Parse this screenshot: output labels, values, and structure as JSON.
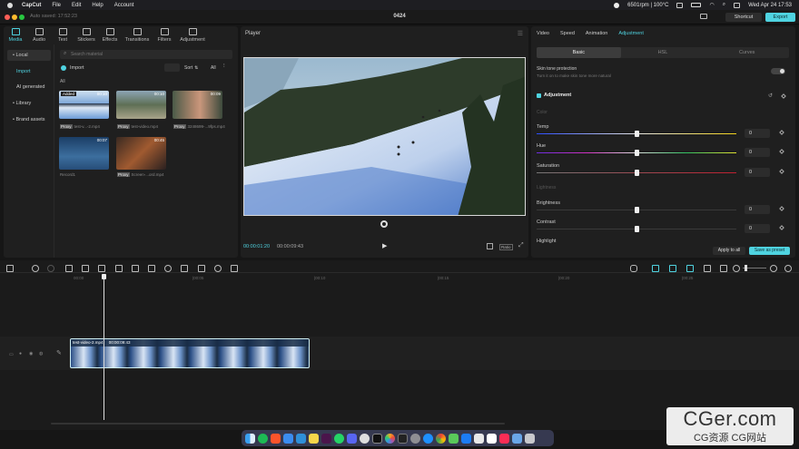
{
  "menubar": {
    "app": "CapCut",
    "items": [
      "File",
      "Edit",
      "Help",
      "Account"
    ],
    "status": "6501rpm | 100°C",
    "datetime": "Wed Apr 24  17:53"
  },
  "titlebar": {
    "autosaved": "Auto saved: 17:52:23",
    "project": "0424",
    "shortcut": "Shortcut",
    "export": "Export"
  },
  "media": {
    "tabs": [
      "Media",
      "Audio",
      "Text",
      "Stickers",
      "Effects",
      "Transitions",
      "Filters",
      "Adjustment"
    ],
    "side": [
      "• Local",
      "Import",
      "AI generated",
      "• Library",
      "• Brand assets"
    ],
    "search_placeholder": "Search material",
    "import_label": "Import",
    "sort": "Sort",
    "all_filter": "All",
    "section": "All",
    "clips": [
      {
        "badge": "Added",
        "duration": "00:10",
        "tag": "Proxy",
        "name": "test-v...-2.mp4"
      },
      {
        "duration": "00:10",
        "tag": "Proxy",
        "name": "test-video.mp4"
      },
      {
        "duration": "00:09",
        "tag": "Proxy",
        "name": "3248699-...9fps.mp4"
      },
      {
        "duration": "00:07",
        "tag": "",
        "name": "Record1"
      },
      {
        "duration": "00:45",
        "tag": "Proxy",
        "name": "Screen-...ord.mp4"
      }
    ]
  },
  "player": {
    "title": "Player",
    "current": "00:00:01:20",
    "total": "00:00:09:43",
    "ratio": "Ratio"
  },
  "adjust": {
    "tabs": [
      "Video",
      "Speed",
      "Animation",
      "Adjustment"
    ],
    "subtabs": [
      "Basic",
      "HSL",
      "Curves"
    ],
    "skin_title": "Skin tone protection",
    "skin_desc": "Turn it on to make skin tone more natural",
    "section": "Adjustment",
    "color_heading": "Color",
    "lightness_heading": "Lightness",
    "sliders": [
      {
        "label": "Temp",
        "value": "0",
        "level": 0.5
      },
      {
        "label": "Hue",
        "value": "0",
        "level": 0.5
      },
      {
        "label": "Saturation",
        "value": "0",
        "level": 0.5
      },
      {
        "label": "Brightness",
        "value": "0",
        "level": 0.5
      },
      {
        "label": "Contrast",
        "value": "0",
        "level": 0.5
      },
      {
        "label": "Highlight",
        "value": "",
        "level": 0.5
      }
    ],
    "apply_all": "Apply to all",
    "save_preset": "Save as preset"
  },
  "timeline": {
    "ruler": [
      "00:00",
      "|00:05",
      "|00:10",
      "|00:15",
      "|00:20",
      "|00:25"
    ],
    "clip": {
      "name": "test-video-2.mp4",
      "duration": "00:00:09:43"
    }
  },
  "watermark": {
    "main": "CGer.com",
    "sub": "CG资源 CG网站"
  },
  "colors": {
    "accent": "#4fd3e0",
    "panel": "#1f1f1f",
    "bg": "#161616"
  }
}
